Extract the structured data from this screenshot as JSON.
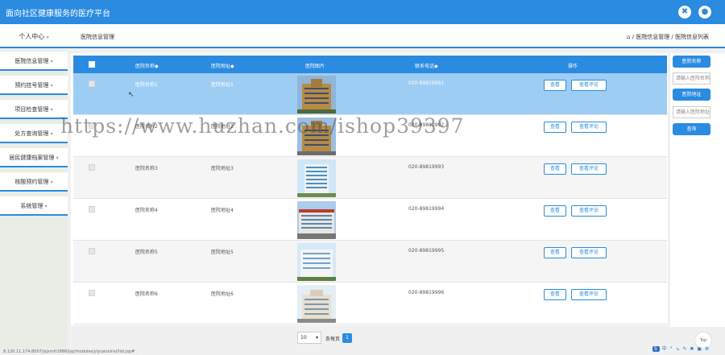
{
  "app": {
    "title": "面向社区健康服务的医疗平台"
  },
  "navbar": {
    "personal_label": "个人中心",
    "page_title": "医院信息管理",
    "breadcrumb": "⌂ / 医院信息管理 / 医院信息列表"
  },
  "sidebar": {
    "items": [
      {
        "label": "医院信息管理"
      },
      {
        "label": "预约挂号管理"
      },
      {
        "label": "项目检查管理"
      },
      {
        "label": "处方查询管理"
      },
      {
        "label": "居民健康档案管理"
      },
      {
        "label": "核酸预约管理"
      },
      {
        "label": "系统管理"
      }
    ]
  },
  "table": {
    "headers": {
      "name": "医院名称◆",
      "address": "医院地址◆",
      "image": "医院图片",
      "phone": "联系电话◆",
      "ops": "操作"
    },
    "view_label": "查看",
    "review_label": "查看评论",
    "rows": [
      {
        "name": "医院名称1",
        "address": "医院地址1",
        "phone": "020-89819991"
      },
      {
        "name": "医院名称2",
        "address": "医院地址2",
        "phone": "020-89819992"
      },
      {
        "name": "医院名称3",
        "address": "医院地址3",
        "phone": "020-89819993"
      },
      {
        "name": "医院名称4",
        "address": "医院地址4",
        "phone": "020-89819994"
      },
      {
        "name": "医院名称5",
        "address": "医院地址5",
        "phone": "020-89819995"
      },
      {
        "name": "医院名称6",
        "address": "医院地址6",
        "phone": "020-89819996"
      }
    ]
  },
  "pager": {
    "page_size": "10",
    "per_page_label": "条每页",
    "current_page": "1"
  },
  "filter": {
    "name_button": "医院名称",
    "name_placeholder": "请输入医院名称",
    "address_button": "医院地址",
    "address_placeholder": "请输入医院地址",
    "search_button": "查询"
  },
  "statusbar": {
    "url": "8.120.11.174:8007/jsjxmfr1886/jsp/modules/yiyuanxinxi/list.jsp#"
  },
  "watermark": "https://www.huzhan.com/ishop39397",
  "top_button": "Top",
  "tray": "中 ° ↘ ✎ ✖ ▣ ⚙",
  "colors": {
    "primary": "#2a8be0",
    "selected_row": "#9ecdf3"
  }
}
